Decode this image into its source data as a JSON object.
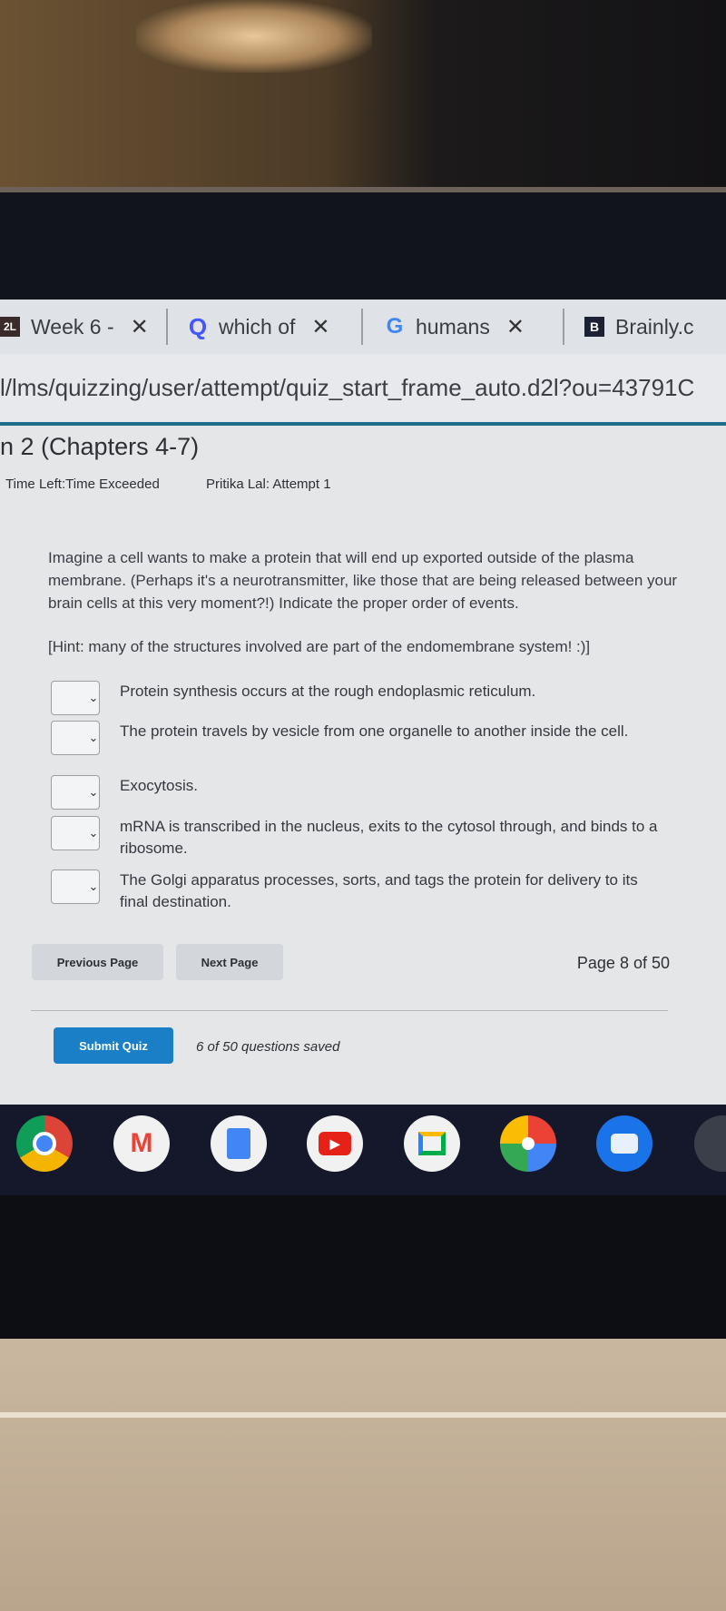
{
  "browser": {
    "tabs": [
      {
        "label": "Week 6 -",
        "icon": "d2l-icon"
      },
      {
        "label": "which of",
        "icon": "quizlet-icon"
      },
      {
        "label": "humans",
        "icon": "google-icon"
      },
      {
        "label": "Brainly.c",
        "icon": "brainly-icon"
      }
    ],
    "url": "l/lms/quizzing/user/attempt/quiz_start_frame_auto.d2l?ou=43791C"
  },
  "quiz": {
    "title": "n 2 (Chapters 4-7)",
    "time_left": "Time Left:Time Exceeded",
    "attempt": "Pritika Lal: Attempt 1",
    "question": "Imagine a cell wants to make a protein that will end up exported outside of the plasma membrane. (Perhaps it's a neurotransmitter, like those that are being released between your brain cells at this very moment?!) Indicate the proper order of events.",
    "hint": "[Hint: many of the structures involved are part of the endomembrane system! :)]",
    "items": [
      {
        "text": "Protein synthesis occurs at the rough endoplasmic reticulum.",
        "selected": ""
      },
      {
        "text": "The protein travels by vesicle from one organelle to another inside the cell.",
        "selected": ""
      },
      {
        "text": "Exocytosis.",
        "selected": ""
      },
      {
        "text": "mRNA is transcribed in the nucleus, exits to the cytosol through, and binds to a ribosome.",
        "selected": ""
      },
      {
        "text": "The Golgi apparatus processes, sorts, and tags the protein for delivery to its final destination.",
        "selected": ""
      }
    ],
    "prev_label": "Previous Page",
    "next_label": "Next Page",
    "page_indicator": "Page 8 of 50",
    "submit_label": "Submit Quiz",
    "saved_status": "6 of 50 questions saved"
  },
  "dock": [
    "chrome-icon",
    "gmail-icon",
    "docs-icon",
    "youtube-icon",
    "meet-icon",
    "photos-icon",
    "messages-icon"
  ],
  "colors": {
    "accent": "#1a7fc7",
    "teal_bar": "#1d6f88"
  }
}
